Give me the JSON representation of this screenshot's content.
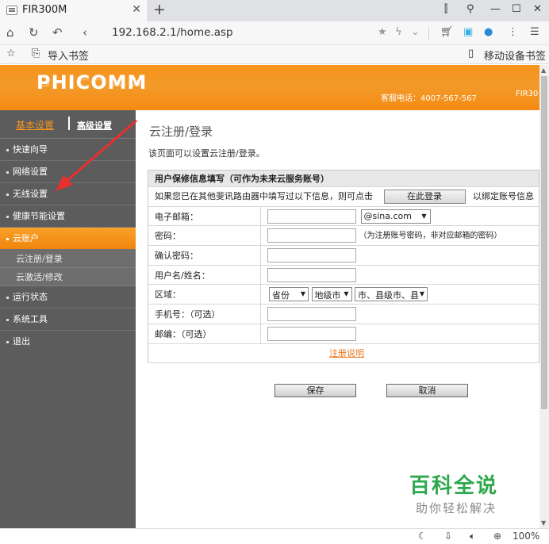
{
  "browser": {
    "tab_title": "FIR300M",
    "tab_close": "✕",
    "new_tab": "+",
    "url": "192.168.2.1/home.asp",
    "bookmarks": {
      "import_label": "导入书签",
      "mobile_label": "移动设备书签"
    },
    "zoom": "100%"
  },
  "router": {
    "logo": "PHICOMM",
    "hotline": "客服电话：4007-567-567",
    "model": "FIR30",
    "sidebar": {
      "tab_basic": "基本设置",
      "tab_advanced": "高级设置",
      "items": [
        {
          "label": "快速向导"
        },
        {
          "label": "网络设置"
        },
        {
          "label": "无线设置"
        },
        {
          "label": "健康节能设置"
        },
        {
          "label": "云账户"
        },
        {
          "label": "运行状态"
        },
        {
          "label": "系统工具"
        },
        {
          "label": "退出"
        }
      ],
      "subitems": [
        {
          "label": "云注册/登录"
        },
        {
          "label": "云激活/修改"
        }
      ]
    },
    "page": {
      "title": "云注册/登录",
      "desc": "该页面可以设置云注册/登录。",
      "table_header": "用户保修信息填写（可作为未来云服务账号）",
      "info_text": "如果您已在其他斐讯路由器中填写过以下信息，则可点击",
      "login_button": "在此登录",
      "bind_text": "以绑定账号信息",
      "rows": {
        "email": "电子邮箱：",
        "email_domain": "@sina.com",
        "password": "密码：",
        "password_hint": "（为注册账号密码，非对应邮箱的密码）",
        "confirm": "确认密码：",
        "username": "用户名/姓名：",
        "region": "区域：",
        "province": "省份",
        "city": "地级市",
        "county": "市、县级市、县",
        "phone": "手机号：（可选）",
        "zip": "邮编：（可选）"
      },
      "register_note": "注册说明",
      "save": "保存",
      "cancel": "取消"
    }
  },
  "watermark": {
    "line1": "百科全说",
    "line2": "助你轻松解决"
  }
}
